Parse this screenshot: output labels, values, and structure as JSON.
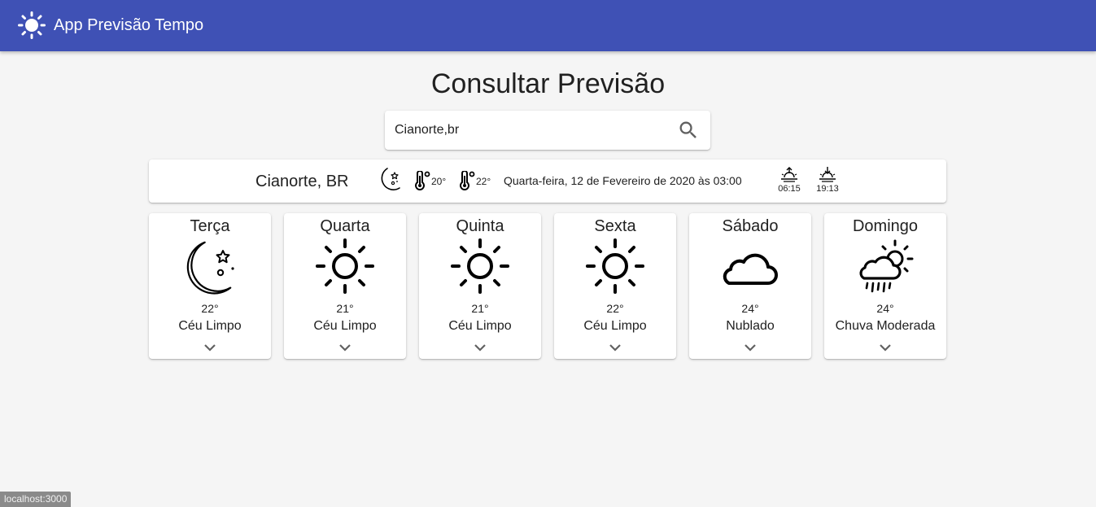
{
  "app": {
    "title": "App Previsão Tempo",
    "logo_icon": "sun-icon",
    "brand_color": "#3f51b5"
  },
  "page": {
    "heading": "Consultar Previsão"
  },
  "search": {
    "value": "Cianorte,br",
    "button_icon": "search-icon"
  },
  "current": {
    "city": "Cianorte, BR",
    "icon": "moon-stars-icon",
    "temp_min": "20°",
    "temp_max": "22°",
    "datetime": "Quarta-feira, 12 de Fevereiro de 2020 às 03:00",
    "sunrise": "06:15",
    "sunset": "19:13"
  },
  "forecast": [
    {
      "day": "Terça",
      "temp": "22°",
      "desc": "Céu Limpo",
      "icon": "moon-stars-icon"
    },
    {
      "day": "Quarta",
      "temp": "21°",
      "desc": "Céu Limpo",
      "icon": "sun-icon"
    },
    {
      "day": "Quinta",
      "temp": "21°",
      "desc": "Céu Limpo",
      "icon": "sun-icon"
    },
    {
      "day": "Sexta",
      "temp": "22°",
      "desc": "Céu Limpo",
      "icon": "sun-icon"
    },
    {
      "day": "Sábado",
      "temp": "24°",
      "desc": "Nublado",
      "icon": "cloud-icon"
    },
    {
      "day": "Domingo",
      "temp": "24°",
      "desc": "Chuva Moderada",
      "icon": "cloud-sun-rain-icon"
    }
  ],
  "status_bar": {
    "url": "localhost:3000"
  }
}
